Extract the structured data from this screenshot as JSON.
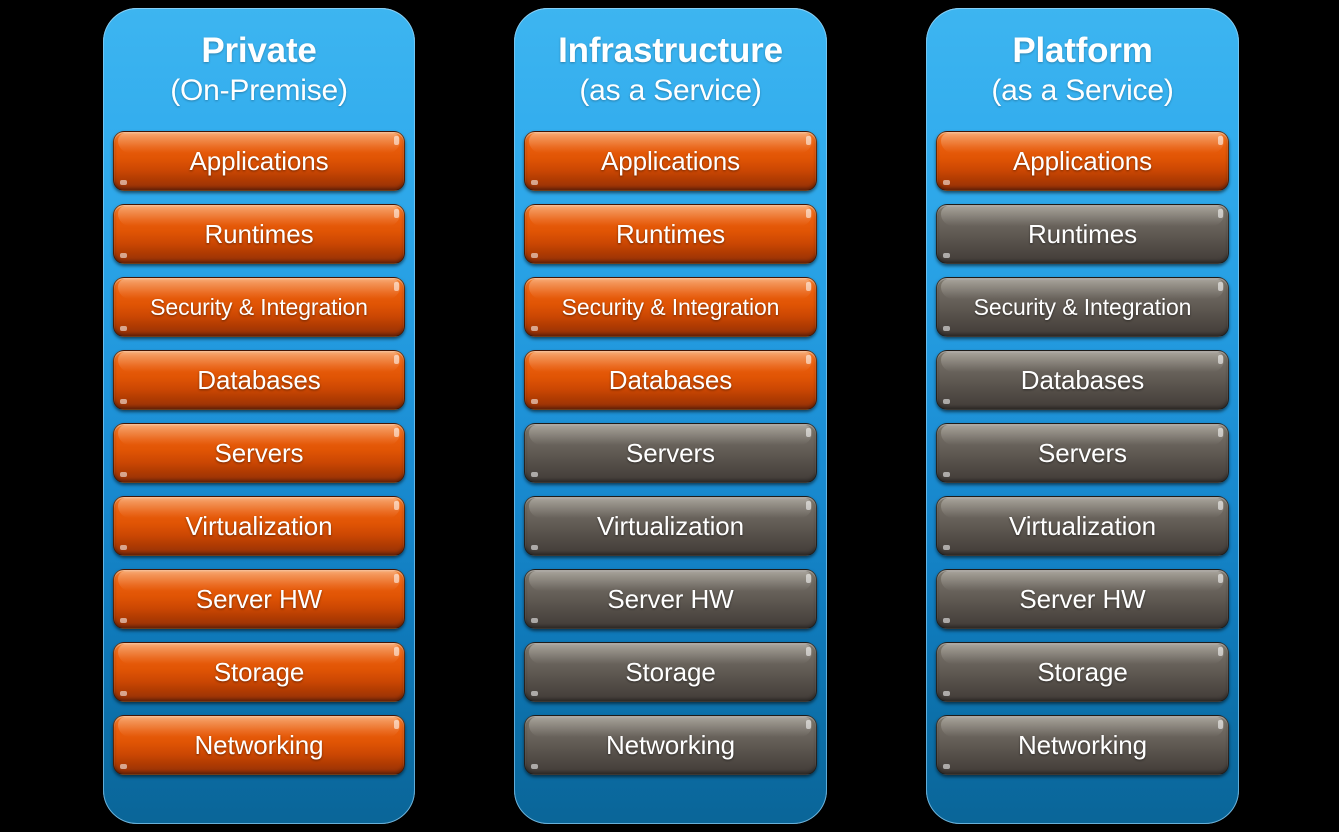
{
  "background": "#000000",
  "theme": {
    "container_blue_top": "#35AEEE",
    "container_blue_bottom": "#0A6598",
    "managed_orange": "#E35205",
    "provider_gray": "#615C56",
    "label_color": "#FFFFFF"
  },
  "layers": [
    "Applications",
    "Runtimes",
    "Security & Integration",
    "Databases",
    "Servers",
    "Virtualization",
    "Server HW",
    "Storage",
    "Networking"
  ],
  "columns": [
    {
      "id": "private-on-premise",
      "title_line1": "Private",
      "title_line2": "(On-Premise)",
      "rows": [
        {
          "label": "Applications",
          "color": "orange",
          "small": false
        },
        {
          "label": "Runtimes",
          "color": "orange",
          "small": false
        },
        {
          "label": "Security & Integration",
          "color": "orange",
          "small": true
        },
        {
          "label": "Databases",
          "color": "orange",
          "small": false
        },
        {
          "label": "Servers",
          "color": "orange",
          "small": false
        },
        {
          "label": "Virtualization",
          "color": "orange",
          "small": false
        },
        {
          "label": "Server HW",
          "color": "orange",
          "small": false
        },
        {
          "label": "Storage",
          "color": "orange",
          "small": false
        },
        {
          "label": "Networking",
          "color": "orange",
          "small": false
        }
      ]
    },
    {
      "id": "infrastructure-as-a-service",
      "title_line1": "Infrastructure",
      "title_line2": "(as a Service)",
      "rows": [
        {
          "label": "Applications",
          "color": "orange",
          "small": false
        },
        {
          "label": "Runtimes",
          "color": "orange",
          "small": false
        },
        {
          "label": "Security & Integration",
          "color": "orange",
          "small": true
        },
        {
          "label": "Databases",
          "color": "orange",
          "small": false
        },
        {
          "label": "Servers",
          "color": "gray",
          "small": false
        },
        {
          "label": "Virtualization",
          "color": "gray",
          "small": false
        },
        {
          "label": "Server HW",
          "color": "gray",
          "small": false
        },
        {
          "label": "Storage",
          "color": "gray",
          "small": false
        },
        {
          "label": "Networking",
          "color": "gray",
          "small": false
        }
      ]
    },
    {
      "id": "platform-as-a-service",
      "title_line1": "Platform",
      "title_line2": "(as a Service)",
      "rows": [
        {
          "label": "Applications",
          "color": "orange",
          "small": false
        },
        {
          "label": "Runtimes",
          "color": "gray",
          "small": false
        },
        {
          "label": "Security & Integration",
          "color": "gray",
          "small": true
        },
        {
          "label": "Databases",
          "color": "gray",
          "small": false
        },
        {
          "label": "Servers",
          "color": "gray",
          "small": false
        },
        {
          "label": "Virtualization",
          "color": "gray",
          "small": false
        },
        {
          "label": "Server HW",
          "color": "gray",
          "small": false
        },
        {
          "label": "Storage",
          "color": "gray",
          "small": false
        },
        {
          "label": "Networking",
          "color": "gray",
          "small": false
        }
      ]
    }
  ]
}
